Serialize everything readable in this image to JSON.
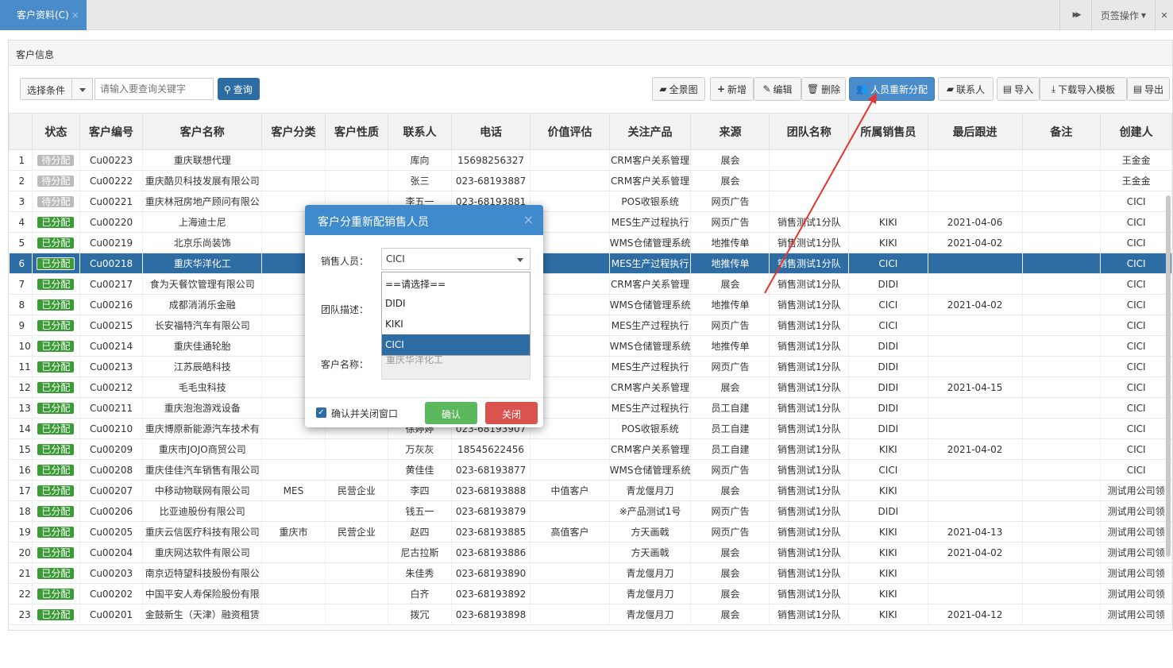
{
  "tabs": {
    "active_label": "客户资料(C)",
    "close_glyph": "×",
    "forward_glyph": "▶▶",
    "ops_label": "页签操作",
    "fullscreen_glyph": "✕"
  },
  "panel": {
    "title": "客户信息"
  },
  "search": {
    "condition_label": "选择条件",
    "placeholder": "请输入要查询关键字",
    "query_label": "查询"
  },
  "toolbar": {
    "panorama": "全景图",
    "add": "新增",
    "edit": "编辑",
    "delete": "删除",
    "reassign": "人员重新分配",
    "contacts": "联系人",
    "import": "导入",
    "download_template": "下载导入模板",
    "export": "导出"
  },
  "columns": [
    "",
    "状态",
    "客户编号",
    "客户名称",
    "客户分类",
    "客户性质",
    "联系人",
    "电话",
    "价值评估",
    "关注产品",
    "来源",
    "团队名称",
    "所属销售员",
    "最后跟进",
    "备注",
    "创建人"
  ],
  "rows": [
    {
      "n": "1",
      "status": "待分配",
      "code": "Cu00223",
      "name": "重庆联想代理",
      "cat": "",
      "nature": "",
      "contact": "库向",
      "phone": "15698256327",
      "value": "",
      "product": "CRM客户关系管理",
      "source": "展会",
      "team": "",
      "sales": "",
      "follow": "",
      "note": "",
      "creator": "王金金"
    },
    {
      "n": "2",
      "status": "待分配",
      "code": "Cu00222",
      "name": "重庆酷贝科技发展有限公司",
      "cat": "",
      "nature": "",
      "contact": "张三",
      "phone": "023-68193887",
      "value": "",
      "product": "CRM客户关系管理",
      "source": "展会",
      "team": "",
      "sales": "",
      "follow": "",
      "note": "",
      "creator": "王金金"
    },
    {
      "n": "3",
      "status": "待分配",
      "code": "Cu00221",
      "name": "重庆林冠房地产顾问有限公",
      "cat": "",
      "nature": "",
      "contact": "李五一",
      "phone": "023-68193881",
      "value": "",
      "product": "POS收银系统",
      "source": "网页广告",
      "team": "",
      "sales": "",
      "follow": "",
      "note": "",
      "creator": "CICI"
    },
    {
      "n": "4",
      "status": "已分配",
      "code": "Cu00220",
      "name": "上海迪士尼",
      "cat": "",
      "nature": "",
      "contact": "",
      "phone": "",
      "value": "",
      "product": "MES生产过程执行",
      "source": "网页广告",
      "team": "销售测试1分队",
      "sales": "KIKI",
      "follow": "2021-04-06",
      "note": "",
      "creator": "CICI"
    },
    {
      "n": "5",
      "status": "已分配",
      "code": "Cu00219",
      "name": "北京乐尚装饰",
      "cat": "",
      "nature": "",
      "contact": "",
      "phone": "",
      "value": "",
      "product": "WMS仓储管理系统",
      "source": "地推传单",
      "team": "销售测试1分队",
      "sales": "KIKI",
      "follow": "2021-04-02",
      "note": "",
      "creator": "CICI"
    },
    {
      "n": "6",
      "status": "已分配",
      "code": "Cu00218",
      "name": "重庆华洋化工",
      "cat": "",
      "nature": "",
      "contact": "",
      "phone": "",
      "value": "",
      "product": "MES生产过程执行",
      "source": "地推传单",
      "team": "销售测试1分队",
      "sales": "CICI",
      "follow": "",
      "note": "",
      "creator": "CICI"
    },
    {
      "n": "7",
      "status": "已分配",
      "code": "Cu00217",
      "name": "食为天餐饮管理有限公司",
      "cat": "",
      "nature": "",
      "contact": "",
      "phone": "",
      "value": "",
      "product": "CRM客户关系管理",
      "source": "展会",
      "team": "销售测试1分队",
      "sales": "DIDI",
      "follow": "",
      "note": "",
      "creator": "CICI"
    },
    {
      "n": "8",
      "status": "已分配",
      "code": "Cu00216",
      "name": "成都消消乐金融",
      "cat": "",
      "nature": "",
      "contact": "",
      "phone": "",
      "value": "",
      "product": "WMS仓储管理系统",
      "source": "地推传单",
      "team": "销售测试1分队",
      "sales": "CICI",
      "follow": "2021-04-02",
      "note": "",
      "creator": "CICI"
    },
    {
      "n": "9",
      "status": "已分配",
      "code": "Cu00215",
      "name": "长安福特汽车有限公司",
      "cat": "",
      "nature": "",
      "contact": "",
      "phone": "",
      "value": "",
      "product": "MES生产过程执行",
      "source": "网页广告",
      "team": "销售测试1分队",
      "sales": "CICI",
      "follow": "",
      "note": "",
      "creator": "CICI"
    },
    {
      "n": "10",
      "status": "已分配",
      "code": "Cu00214",
      "name": "重庆佳通轮胎",
      "cat": "",
      "nature": "",
      "contact": "",
      "phone": "",
      "value": "",
      "product": "WMS仓储管理系统",
      "source": "地推传单",
      "team": "销售测试1分队",
      "sales": "DIDI",
      "follow": "",
      "note": "",
      "creator": "CICI"
    },
    {
      "n": "11",
      "status": "已分配",
      "code": "Cu00213",
      "name": "江苏辰皓科技",
      "cat": "",
      "nature": "",
      "contact": "",
      "phone": "",
      "value": "",
      "product": "MES生产过程执行",
      "source": "网页广告",
      "team": "销售测试1分队",
      "sales": "DIDI",
      "follow": "",
      "note": "",
      "creator": "CICI"
    },
    {
      "n": "12",
      "status": "已分配",
      "code": "Cu00212",
      "name": "毛毛虫科技",
      "cat": "",
      "nature": "",
      "contact": "",
      "phone": "",
      "value": "",
      "product": "CRM客户关系管理",
      "source": "展会",
      "team": "销售测试1分队",
      "sales": "DIDI",
      "follow": "2021-04-15",
      "note": "",
      "creator": "CICI"
    },
    {
      "n": "13",
      "status": "已分配",
      "code": "Cu00211",
      "name": "重庆泡泡游戏设备",
      "cat": "",
      "nature": "",
      "contact": "",
      "phone": "",
      "value": "",
      "product": "MES生产过程执行",
      "source": "员工自建",
      "team": "销售测试1分队",
      "sales": "DIDI",
      "follow": "",
      "note": "",
      "creator": "CICI"
    },
    {
      "n": "14",
      "status": "已分配",
      "code": "Cu00210",
      "name": "重庆博原新能源汽车技术有",
      "cat": "",
      "nature": "",
      "contact": "徐婷婷",
      "phone": "023-68193907",
      "value": "",
      "product": "POS收银系统",
      "source": "员工自建",
      "team": "销售测试1分队",
      "sales": "DIDI",
      "follow": "",
      "note": "",
      "creator": "CICI"
    },
    {
      "n": "15",
      "status": "已分配",
      "code": "Cu00209",
      "name": "重庆市JOJO商贸公司",
      "cat": "",
      "nature": "",
      "contact": "万灰灰",
      "phone": "18545622456",
      "value": "",
      "product": "CRM客户关系管理",
      "source": "员工自建",
      "team": "销售测试1分队",
      "sales": "KIKI",
      "follow": "2021-04-02",
      "note": "",
      "creator": "CICI"
    },
    {
      "n": "16",
      "status": "已分配",
      "code": "Cu00208",
      "name": "重庆佳佳汽车销售有限公司",
      "cat": "",
      "nature": "",
      "contact": "黄佳佳",
      "phone": "023-68193877",
      "value": "",
      "product": "WMS仓储管理系统",
      "source": "网页广告",
      "team": "销售测试1分队",
      "sales": "CICI",
      "follow": "",
      "note": "",
      "creator": "CICI"
    },
    {
      "n": "17",
      "status": "已分配",
      "code": "Cu00207",
      "name": "中移动物联网有限公司",
      "cat": "MES",
      "nature": "民营企业",
      "contact": "李四",
      "phone": "023-68193888",
      "value": "中值客户",
      "product": "青龙偃月刀",
      "source": "展会",
      "team": "销售测试1分队",
      "sales": "KIKI",
      "follow": "",
      "note": "",
      "creator": "测试用公司领"
    },
    {
      "n": "18",
      "status": "已分配",
      "code": "Cu00206",
      "name": "比亚迪股份有限公司",
      "cat": "",
      "nature": "",
      "contact": "钱五一",
      "phone": "023-68193879",
      "value": "",
      "product": "※产品测试1号",
      "source": "网页广告",
      "team": "销售测试1分队",
      "sales": "DIDI",
      "follow": "",
      "note": "",
      "creator": "测试用公司领"
    },
    {
      "n": "19",
      "status": "已分配",
      "code": "Cu00205",
      "name": "重庆云信医疗科技有限公司",
      "cat": "重庆市",
      "nature": "民营企业",
      "contact": "赵四",
      "phone": "023-68193885",
      "value": "高值客户",
      "product": "方天画戟",
      "source": "网页广告",
      "team": "销售测试1分队",
      "sales": "KIKI",
      "follow": "2021-04-13",
      "note": "",
      "creator": "测试用公司领"
    },
    {
      "n": "20",
      "status": "已分配",
      "code": "Cu00204",
      "name": "重庆网达软件有限公司",
      "cat": "",
      "nature": "",
      "contact": "尼古拉斯",
      "phone": "023-68193886",
      "value": "",
      "product": "方天画戟",
      "source": "展会",
      "team": "销售测试1分队",
      "sales": "KIKI",
      "follow": "2021-04-02",
      "note": "",
      "creator": "测试用公司领"
    },
    {
      "n": "21",
      "status": "已分配",
      "code": "Cu00203",
      "name": "南京迈特望科技股份有限公",
      "cat": "",
      "nature": "",
      "contact": "朱佳秀",
      "phone": "023-68193890",
      "value": "",
      "product": "青龙偃月刀",
      "source": "展会",
      "team": "销售测试1分队",
      "sales": "KIKI",
      "follow": "",
      "note": "",
      "creator": "测试用公司领"
    },
    {
      "n": "22",
      "status": "已分配",
      "code": "Cu00202",
      "name": "中国平安人寿保险股份有限",
      "cat": "",
      "nature": "",
      "contact": "白齐",
      "phone": "023-68193892",
      "value": "",
      "product": "青龙偃月刀",
      "source": "展会",
      "team": "销售测试1分队",
      "sales": "KIKI",
      "follow": "",
      "note": "",
      "creator": "测试用公司领"
    },
    {
      "n": "23",
      "status": "已分配",
      "code": "Cu00201",
      "name": "金鼓新生（天津）融资租赁",
      "cat": "",
      "nature": "",
      "contact": "拨冗",
      "phone": "023-68193898",
      "value": "",
      "product": "青龙偃月刀",
      "source": "展会",
      "team": "销售测试1分队",
      "sales": "KIKI",
      "follow": "2021-04-12",
      "note": "",
      "creator": "测试用公司领"
    }
  ],
  "selected_row_index": 5,
  "modal": {
    "title": "客户分重新配销售人员",
    "close_glyph": "×",
    "sales_label": "销售人员：",
    "sales_value": "CICI",
    "options": [
      "==请选择==",
      "DIDI",
      "KIKI",
      "CICI"
    ],
    "selected_option_index": 3,
    "team_label": "团队描述：",
    "customer_label": "客户名称：",
    "customer_value": "重庆华洋化工",
    "confirm_close_label": "确认并关闭窗口",
    "confirm_label": "确认",
    "close_label": "关闭"
  },
  "colors": {
    "accent": "#4a8cc9",
    "selected_row": "#2e6da4",
    "assigned_badge": "#3a9c35",
    "pending_badge": "#bbbbbb",
    "confirm_button": "#5cb85c",
    "close_button": "#d9534f",
    "annotation_arrow": "#e8322f"
  }
}
